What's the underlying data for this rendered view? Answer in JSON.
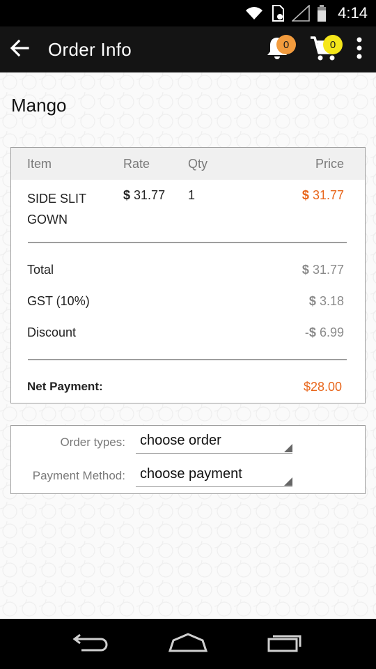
{
  "status_bar": {
    "time": "4:14"
  },
  "app_bar": {
    "title": "Order Info",
    "notifications_count": "0",
    "cart_count": "0"
  },
  "shop": {
    "name": "Mango"
  },
  "order_table": {
    "headers": {
      "item": "Item",
      "rate": "Rate",
      "qty": "Qty",
      "price": "Price"
    },
    "items": [
      {
        "name_line1": "SIDE SLIT",
        "name_line2": "GOWN",
        "rate_symbol": "$",
        "rate": "31.77",
        "qty": "1",
        "price_symbol": "$",
        "price": "31.77"
      }
    ],
    "summary": {
      "total_label": "Total",
      "total_symbol": "$",
      "total_value": "31.77",
      "gst_label": "GST (10%)",
      "gst_symbol": "$",
      "gst_value": "3.18",
      "discount_label": "Discount",
      "discount_prefix": "-",
      "discount_symbol": "$",
      "discount_value": "6.99",
      "net_label": "Net Payment:",
      "net_value": "$28.00"
    }
  },
  "selectors": {
    "order_type_label": "Order types:",
    "order_type_value": "choose order",
    "payment_label": "Payment Method:",
    "payment_value": "choose payment"
  },
  "colors": {
    "accent": "#e8651a",
    "notification_badge": "#f29b3d",
    "cart_badge": "#f5e61a",
    "app_bar": "#141414"
  },
  "icons": [
    "wifi-icon",
    "sim-icon",
    "signal-icon",
    "battery-icon",
    "back-arrow-icon",
    "bell-icon",
    "cart-icon",
    "more-vert-icon",
    "nav-back-icon",
    "nav-home-icon",
    "nav-recents-icon"
  ]
}
